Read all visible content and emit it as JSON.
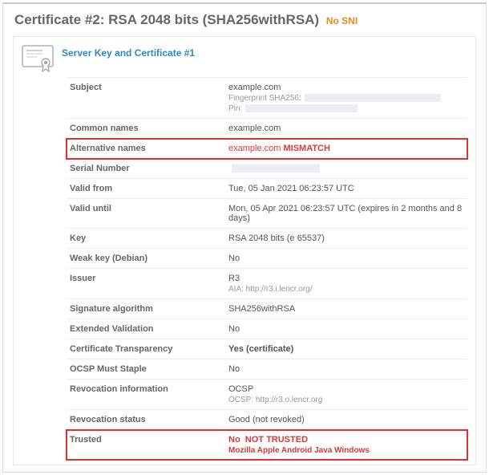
{
  "header": {
    "title": "Certificate #2: RSA 2048 bits (SHA256withRSA)",
    "badge": "No SNI"
  },
  "card": {
    "title": "Server Key and Certificate #1",
    "subject": {
      "label": "Subject",
      "value": "example.com",
      "fp_label": "Fingerprint SHA256:",
      "pin_label": "Pin:"
    },
    "rows": {
      "common_names": {
        "label": "Common names",
        "value": "example.com"
      },
      "alt_names": {
        "label": "Alternative names",
        "value": "example.com",
        "flag": "MISMATCH"
      },
      "serial": {
        "label": "Serial Number",
        "value": ""
      },
      "valid_from": {
        "label": "Valid from",
        "value": "Tue, 05 Jan 2021 06:23:57 UTC"
      },
      "valid_until": {
        "label": "Valid until",
        "value": "Mon, 05 Apr 2021 06:23:57 UTC (expires in 2 months and 8 days)"
      },
      "key": {
        "label": "Key",
        "value": "RSA 2048 bits (e 65537)"
      },
      "weak_key": {
        "label": "Weak key (Debian)",
        "value": "No"
      },
      "issuer": {
        "label": "Issuer",
        "value": "R3",
        "sub": "AIA: http://r3.i.lencr.org/"
      },
      "sig_alg": {
        "label": "Signature algorithm",
        "value": "SHA256withRSA"
      },
      "ev": {
        "label": "Extended Validation",
        "value": "No"
      },
      "ct": {
        "label": "Certificate Transparency",
        "value": "Yes (certificate)"
      },
      "ocsp_must": {
        "label": "OCSP Must Staple",
        "value": "No"
      },
      "revocation_info": {
        "label": "Revocation information",
        "value": "OCSP",
        "sub": "OCSP: http://r3.o.lencr.org"
      },
      "revocation_status": {
        "label": "Revocation status",
        "value": "Good (not revoked)"
      },
      "trusted": {
        "label": "Trusted",
        "value": "No",
        "flag": "NOT TRUSTED",
        "sub": "Mozilla  Apple  Android  Java  Windows"
      }
    }
  }
}
